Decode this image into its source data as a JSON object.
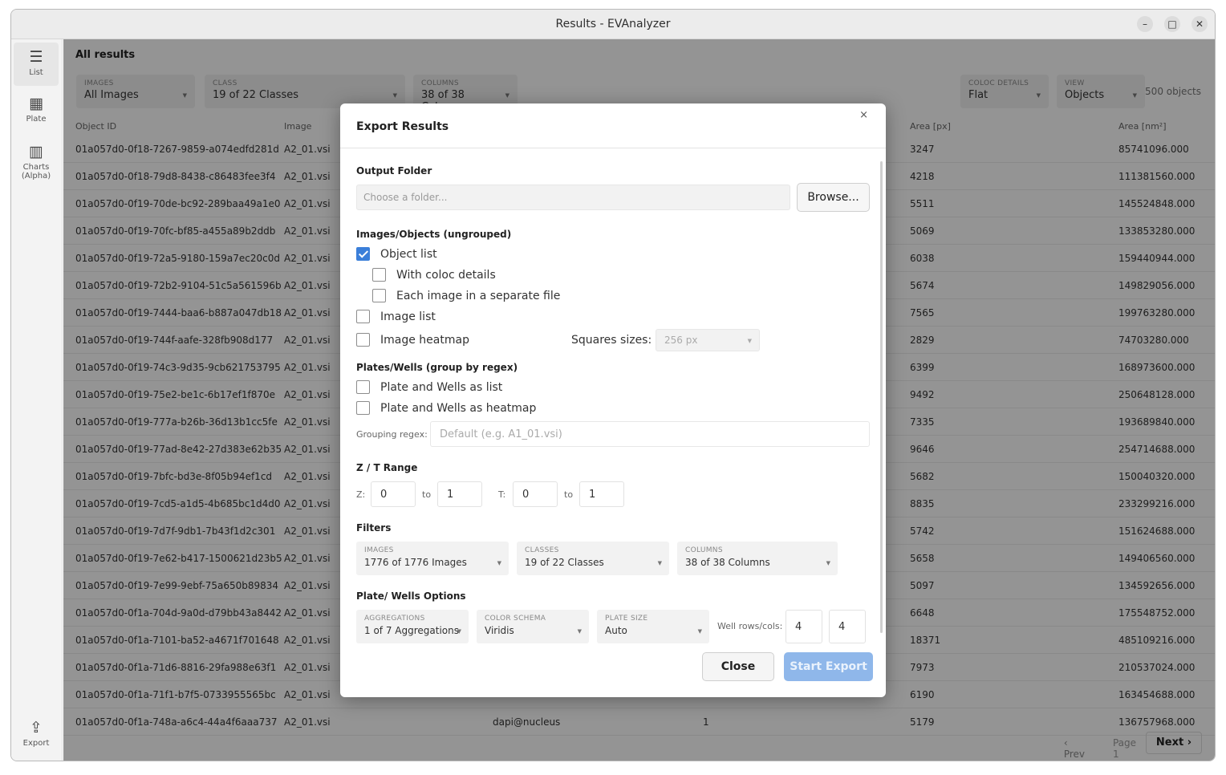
{
  "window": {
    "title": "Results - EVAnalyzer",
    "minimize": "–",
    "maximize": "□",
    "close": "✕"
  },
  "sidebar": {
    "list": {
      "icon": "☰",
      "label": "List"
    },
    "plate": {
      "icon": "▦",
      "label": "Plate"
    },
    "charts": {
      "icon": "▥",
      "label": "Charts (Alpha)"
    },
    "export": {
      "icon": "⇪",
      "label": "Export"
    }
  },
  "main": {
    "heading": "All results",
    "filters": {
      "images": {
        "label": "IMAGES",
        "value": "All Images"
      },
      "class": {
        "label": "CLASS",
        "value": "19 of 22 Classes"
      },
      "columns": {
        "label": "COLUMNS",
        "value": "38 of 38 Columns"
      },
      "coloc": {
        "label": "COLOC DETAILS",
        "value": "Flat"
      },
      "view": {
        "label": "VIEW",
        "value": "Objects"
      }
    },
    "object_count": "500 objects",
    "columns": {
      "object_id": "Object ID",
      "image": "Image",
      "area_px": "Area [px]",
      "area_nm": "Area [nm²]"
    },
    "rows": [
      {
        "id": "01a057d0-0f18-7267-9859-a074edfd281d",
        "image": "A2_01.vsi",
        "area_px": "3247",
        "area_nm": "85741096.000"
      },
      {
        "id": "01a057d0-0f18-79d8-8438-c86483fee3f4",
        "image": "A2_01.vsi",
        "area_px": "4218",
        "area_nm": "111381560.000"
      },
      {
        "id": "01a057d0-0f19-70de-bc92-289baa49a1e0",
        "image": "A2_01.vsi",
        "area_px": "5511",
        "area_nm": "145524848.000"
      },
      {
        "id": "01a057d0-0f19-70fc-bf85-a455a89b2ddb",
        "image": "A2_01.vsi",
        "area_px": "5069",
        "area_nm": "133853280.000"
      },
      {
        "id": "01a057d0-0f19-72a5-9180-159a7ec20c0d",
        "image": "A2_01.vsi",
        "area_px": "6038",
        "area_nm": "159440944.000"
      },
      {
        "id": "01a057d0-0f19-72b2-9104-51c5a561596b",
        "image": "A2_01.vsi",
        "area_px": "5674",
        "area_nm": "149829056.000"
      },
      {
        "id": "01a057d0-0f19-7444-baa6-b887a047db18",
        "image": "A2_01.vsi",
        "area_px": "7565",
        "area_nm": "199763280.000"
      },
      {
        "id": "01a057d0-0f19-744f-aafe-328fb908d177",
        "image": "A2_01.vsi",
        "area_px": "2829",
        "area_nm": "74703280.000"
      },
      {
        "id": "01a057d0-0f19-74c3-9d35-9cb621753795",
        "image": "A2_01.vsi",
        "area_px": "6399",
        "area_nm": "168973600.000"
      },
      {
        "id": "01a057d0-0f19-75e2-be1c-6b17ef1f870e",
        "image": "A2_01.vsi",
        "area_px": "9492",
        "area_nm": "250648128.000"
      },
      {
        "id": "01a057d0-0f19-777a-b26b-36d13b1cc5fe",
        "image": "A2_01.vsi",
        "area_px": "7335",
        "area_nm": "193689840.000"
      },
      {
        "id": "01a057d0-0f19-77ad-8e42-27d383e62b35",
        "image": "A2_01.vsi",
        "area_px": "9646",
        "area_nm": "254714688.000"
      },
      {
        "id": "01a057d0-0f19-7bfc-bd3e-8f05b94ef1cd",
        "image": "A2_01.vsi",
        "area_px": "5682",
        "area_nm": "150040320.000"
      },
      {
        "id": "01a057d0-0f19-7cd5-a1d5-4b685bc1d4d0",
        "image": "A2_01.vsi",
        "area_px": "8835",
        "area_nm": "233299216.000"
      },
      {
        "id": "01a057d0-0f19-7d7f-9db1-7b43f1d2c301",
        "image": "A2_01.vsi",
        "area_px": "5742",
        "area_nm": "151624688.000"
      },
      {
        "id": "01a057d0-0f19-7e62-b417-1500621d23b5",
        "image": "A2_01.vsi",
        "area_px": "5658",
        "area_nm": "149406560.000"
      },
      {
        "id": "01a057d0-0f19-7e99-9ebf-75a650b89834",
        "image": "A2_01.vsi",
        "area_px": "5097",
        "area_nm": "134592656.000"
      },
      {
        "id": "01a057d0-0f1a-704d-9a0d-d79bb43a8442",
        "image": "A2_01.vsi",
        "area_px": "6648",
        "area_nm": "175548752.000"
      },
      {
        "id": "01a057d0-0f1a-7101-ba52-a4671f701648",
        "image": "A2_01.vsi",
        "area_px": "18371",
        "area_nm": "485109216.000"
      },
      {
        "id": "01a057d0-0f1a-71d6-8816-29fa988e63f1",
        "image": "A2_01.vsi",
        "area_px": "7973",
        "area_nm": "210537024.000"
      },
      {
        "id": "01a057d0-0f1a-71f1-b7f5-0733955565bc",
        "image": "A2_01.vsi",
        "area_px": "6190",
        "area_nm": "163454688.000"
      },
      {
        "id": "01a057d0-0f1a-748a-a6c4-44a4f6aaa737",
        "image": "A2_01.vsi",
        "class": "dapi@nucleus",
        "count": "1",
        "area_px": "5179",
        "area_nm": "136757968.000"
      }
    ],
    "pager": {
      "prev": "‹ Prev",
      "page": "Page 1",
      "next": "Next ›"
    }
  },
  "modal": {
    "title": "Export Results",
    "close": "×",
    "output_folder": {
      "heading": "Output Folder",
      "placeholder": "Choose a folder...",
      "browse": "Browse..."
    },
    "images_objects": {
      "heading": "Images/Objects (ungrouped)",
      "object_list": "Object list",
      "with_coloc": "With coloc details",
      "each_image": "Each image in a separate file",
      "image_list": "Image list",
      "image_heatmap": "Image heatmap",
      "squares_label": "Squares sizes:",
      "squares_value": "256 px"
    },
    "plates_wells": {
      "heading": "Plates/Wells (group by regex)",
      "as_list": "Plate and Wells as list",
      "as_heatmap": "Plate and Wells as heatmap",
      "regex_label": "Grouping regex:",
      "regex_placeholder": "Default (e.g. A1_01.vsi)"
    },
    "zt_range": {
      "heading": "Z / T Range",
      "z_label": "Z:",
      "z_from": "0",
      "to": "to",
      "z_to": "1",
      "t_label": "T:",
      "t_from": "0",
      "t_to": "1"
    },
    "filters": {
      "heading": "Filters",
      "images": {
        "label": "IMAGES",
        "value": "1776 of 1776 Images"
      },
      "classes": {
        "label": "CLASSES",
        "value": "19 of 22 Classes"
      },
      "columns": {
        "label": "COLUMNS",
        "value": "38 of 38 Columns"
      }
    },
    "plate_options": {
      "heading": "Plate/ Wells Options",
      "aggregations": {
        "label": "AGGREGATIONS",
        "value": "1 of 7 Aggregations"
      },
      "color_schema": {
        "label": "COLOR SCHEMA",
        "value": "Viridis"
      },
      "plate_size": {
        "label": "PLATE SIZE",
        "value": "Auto"
      },
      "well_label": "Well rows/cols:",
      "rows": "4",
      "cols": "4"
    },
    "buttons": {
      "close": "Close",
      "start": "Start Export"
    }
  },
  "colors": {
    "accent": "#3b7fd9",
    "start_button": "#8fb7ea",
    "scrim": "#000000"
  }
}
